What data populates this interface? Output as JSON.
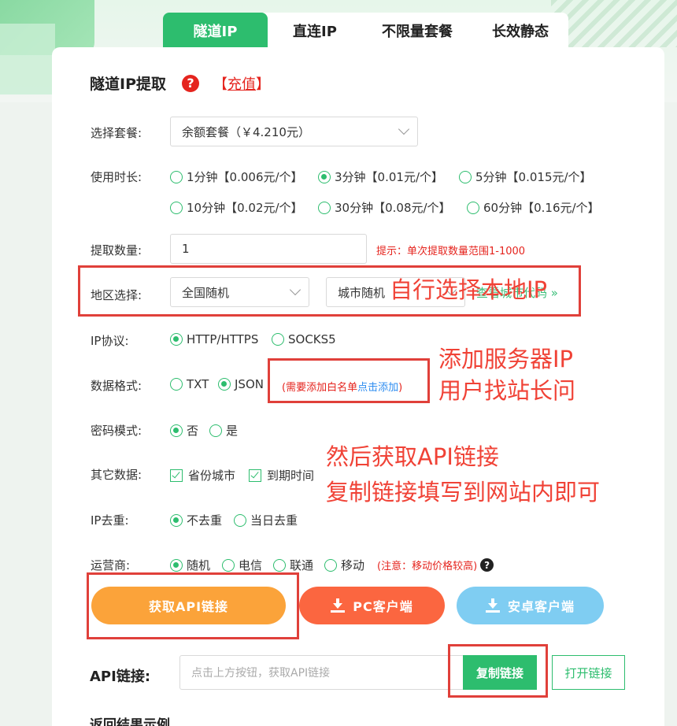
{
  "tabs": [
    "隧道IP",
    "直连IP",
    "不限量套餐",
    "长效静态"
  ],
  "title": "隧道IP提取",
  "help_glyph": "?",
  "recharge": {
    "left": "【",
    "label": "充值",
    "right": "】"
  },
  "package": {
    "label": "选择套餐:",
    "value": "余额套餐（￥4.210元）"
  },
  "duration": {
    "label": "使用时长:",
    "options": [
      {
        "text": "1分钟【0.006元/个】",
        "checked": false
      },
      {
        "text": "3分钟【0.01元/个】",
        "checked": true
      },
      {
        "text": "5分钟【0.015元/个】",
        "checked": false
      },
      {
        "text": "10分钟【0.02元/个】",
        "checked": false
      },
      {
        "text": "30分钟【0.08元/个】",
        "checked": false
      },
      {
        "text": "60分钟【0.16元/个】",
        "checked": false
      }
    ]
  },
  "quantity": {
    "label": "提取数量:",
    "value": "1",
    "hint": "提示：单次提取数量范围1-1000"
  },
  "region": {
    "label": "地区选择:",
    "province": "全国随机",
    "city": "城市随机",
    "link": "查看城市代码 »"
  },
  "protocol": {
    "label": "IP协议:",
    "options": [
      {
        "text": "HTTP/HTTPS",
        "checked": true
      },
      {
        "text": "SOCKS5",
        "checked": false
      }
    ]
  },
  "format": {
    "label": "数据格式:",
    "options": [
      {
        "text": "TXT",
        "checked": false
      },
      {
        "text": "JSON",
        "checked": true
      }
    ],
    "hint_prefix": "(需要添加白名单",
    "hint_link": "点击添加",
    "hint_suffix": ")"
  },
  "password": {
    "label": "密码模式:",
    "options": [
      {
        "text": "否",
        "checked": true
      },
      {
        "text": "是",
        "checked": false
      }
    ]
  },
  "other": {
    "label": "其它数据:",
    "options": [
      {
        "text": "省份城市",
        "checked": true
      },
      {
        "text": "到期时间",
        "checked": true
      }
    ]
  },
  "dedupe": {
    "label": "IP去重:",
    "options": [
      {
        "text": "不去重",
        "checked": true
      },
      {
        "text": "当日去重",
        "checked": false
      }
    ]
  },
  "isp": {
    "label": "运营商:",
    "options": [
      {
        "text": "随机",
        "checked": true
      },
      {
        "text": "电信",
        "checked": false
      },
      {
        "text": "联通",
        "checked": false
      },
      {
        "text": "移动",
        "checked": false
      }
    ],
    "note": "(注意：移动价格较高)"
  },
  "buttons": {
    "get_api": "获取API链接",
    "pc_client": "PC客户端",
    "android_client": "安卓客户端"
  },
  "api": {
    "label": "API链接:",
    "placeholder": "点击上方按钮，获取API链接",
    "copy": "复制链接",
    "open": "打开链接"
  },
  "result_title": "返回结果示例",
  "annotations": {
    "region": "自行选择本地IP",
    "whitelist_1": "添加服务器IP",
    "whitelist_2": "用户找站长问",
    "api_1": "然后获取API链接",
    "api_2": "复制链接填写到网站内即可"
  },
  "colors": {
    "brand_green": "#2dbd6e",
    "annotation_red": "#e0403a",
    "orange": "#fba33a",
    "red_button": "#fb6640",
    "blue_button": "#7fcdf2"
  }
}
